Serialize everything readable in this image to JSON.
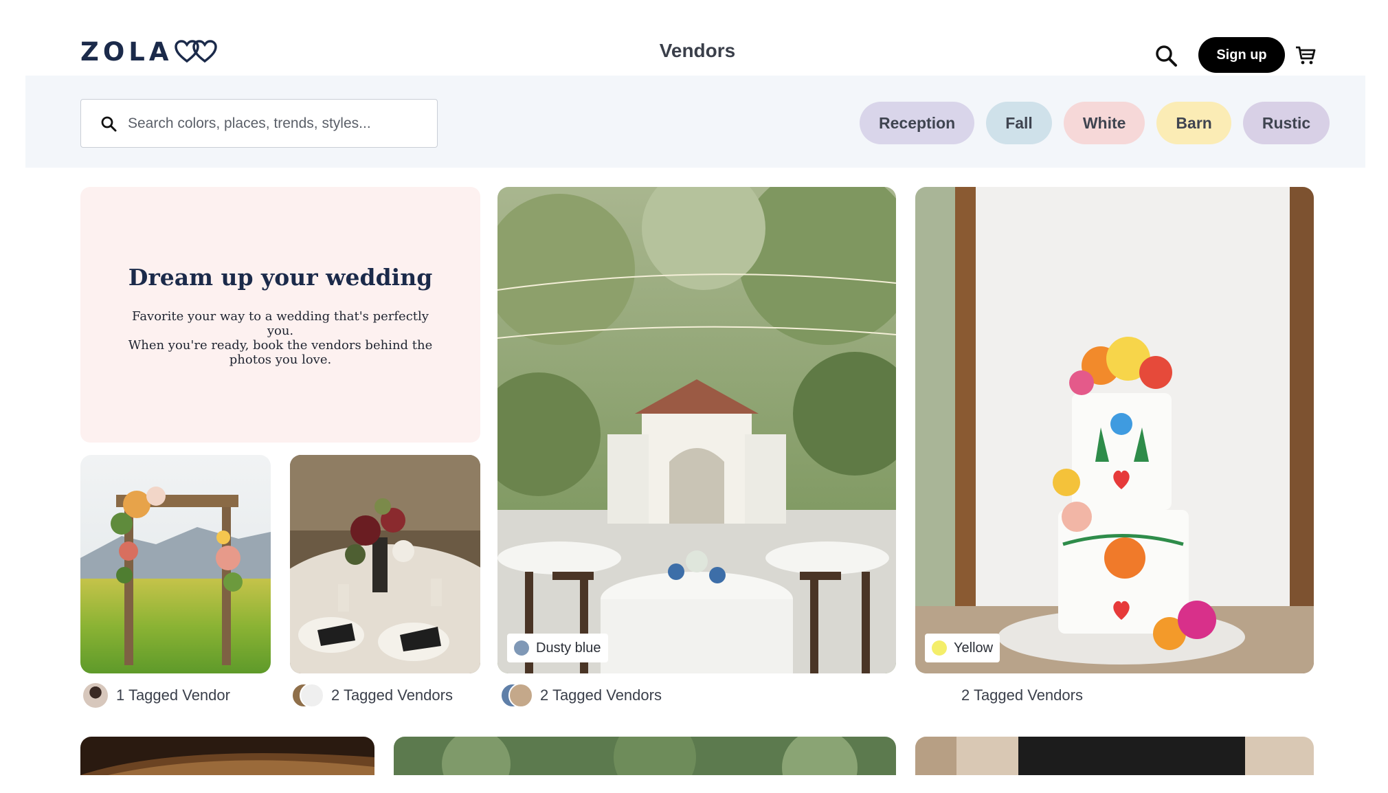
{
  "header": {
    "logo_text": "ZOLA",
    "title": "Vendors",
    "signup_label": "Sign up",
    "icons": {
      "search": "search-icon",
      "cart": "cart-icon"
    }
  },
  "search": {
    "placeholder": "Search colors, places, trends, styles..."
  },
  "chips": [
    {
      "label": "Reception",
      "color": "#d9d5ea"
    },
    {
      "label": "Fall",
      "color": "#cfe1ea"
    },
    {
      "label": "White",
      "color": "#f6d8d8"
    },
    {
      "label": "Barn",
      "color": "#fbecb5"
    },
    {
      "label": "Rustic",
      "color": "#d8d0e6"
    }
  ],
  "intro": {
    "title": "Dream up your wedding",
    "line1": "Favorite your way to a wedding that's perfectly you.",
    "line2": "When you're ready, book the vendors behind the photos you love."
  },
  "cards": [
    {
      "tagged": "1 Tagged Vendor"
    },
    {
      "tagged": "2 Tagged Vendors"
    },
    {
      "tagged": "2 Tagged Vendors",
      "color_tag": "Dusty blue",
      "color": "#7f98b6"
    },
    {
      "tagged": "2 Tagged Vendors",
      "color_tag": "Yellow",
      "color": "#f4ee6a"
    }
  ]
}
